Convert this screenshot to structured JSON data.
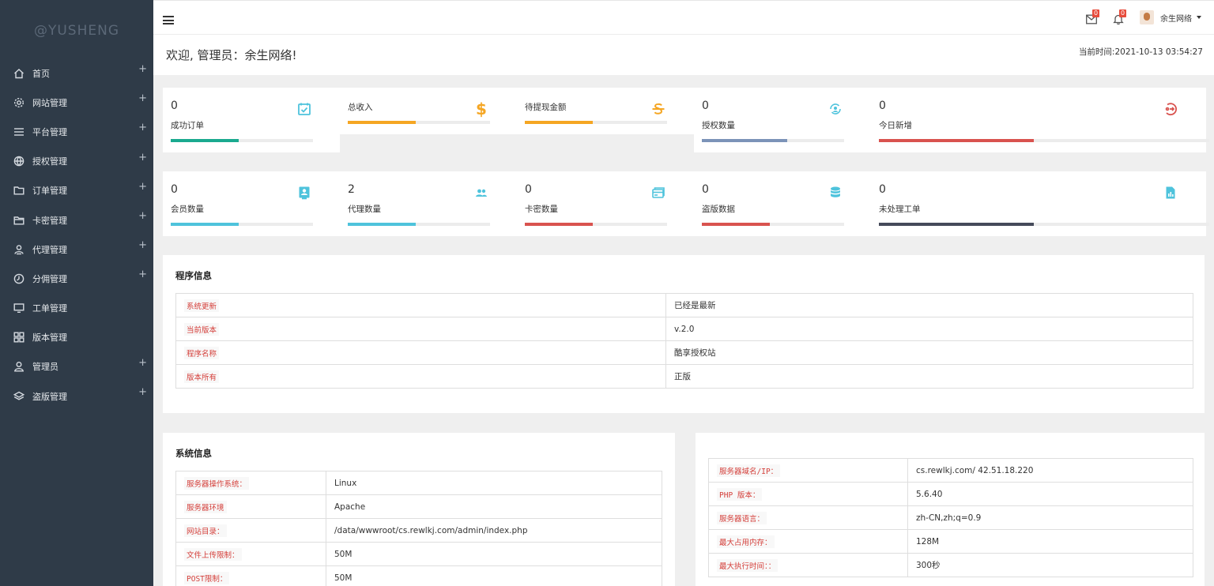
{
  "sidebar": {
    "brand": "@YUSHENG",
    "items": [
      {
        "label": "首页",
        "icon": "home-icon",
        "expandable": true
      },
      {
        "label": "网站管理",
        "icon": "gear-icon",
        "expandable": true
      },
      {
        "label": "平台管理",
        "icon": "menu-lines-icon",
        "expandable": true
      },
      {
        "label": "授权管理",
        "icon": "globe-icon",
        "expandable": true
      },
      {
        "label": "订单管理",
        "icon": "folder-icon",
        "expandable": true
      },
      {
        "label": "卡密管理",
        "icon": "folder-open-icon",
        "expandable": true
      },
      {
        "label": "代理管理",
        "icon": "user-group-icon",
        "expandable": true
      },
      {
        "label": "分佣管理",
        "icon": "clock-icon",
        "expandable": true
      },
      {
        "label": "工单管理",
        "icon": "monitor-icon",
        "expandable": false
      },
      {
        "label": "版本管理",
        "icon": "grid-icon",
        "expandable": false
      },
      {
        "label": "管理员",
        "icon": "user-icon",
        "expandable": true
      },
      {
        "label": "盗版管理",
        "icon": "layers-icon",
        "expandable": true
      }
    ],
    "plus_glyph": "+"
  },
  "topbar": {
    "mail_badge": "0",
    "bell_badge": "0",
    "user_name": "余生网络"
  },
  "welcome": {
    "title": "欢迎, 管理员：余生网络!",
    "time": "当前时间:2021-10-13 03:54:27"
  },
  "stats_row1": [
    {
      "value": "0",
      "label": "成功订单",
      "icon": "calendar-check-icon",
      "color": "#1aa98f",
      "fill": 0.48
    },
    {
      "value": "",
      "label": "总收入",
      "icon": "dollar-icon",
      "color": "#f5a623",
      "fill": 0.48
    },
    {
      "value": "",
      "label": "待提现金额",
      "icon": "strike-s-icon",
      "color": "#f5a623",
      "fill": 0.48
    },
    {
      "value": "0",
      "label": "授权数量",
      "icon": "sync-user-icon",
      "color": "#7b93b8",
      "fill": 0.6
    },
    {
      "value": "0",
      "label": "今日新增",
      "icon": "arrow-circle-icon",
      "color": "#d9534f",
      "fill": 0.47
    }
  ],
  "stats_row2": [
    {
      "value": "0",
      "label": "会员数量",
      "icon": "id-card-icon",
      "color": "#4ec3dc",
      "fill": 0.48
    },
    {
      "value": "2",
      "label": "代理数量",
      "icon": "users-icon",
      "color": "#4ec3dc",
      "fill": 0.48
    },
    {
      "value": "0",
      "label": "卡密数量",
      "icon": "cards-icon",
      "color": "#d9534f",
      "fill": 0.48
    },
    {
      "value": "0",
      "label": "盗版数据",
      "icon": "database-icon",
      "color": "#d9534f",
      "fill": 0.48
    },
    {
      "value": "0",
      "label": "未处理工单",
      "icon": "report-icon",
      "color": "#454a5a",
      "fill": 0.47
    }
  ],
  "program": {
    "title": "程序信息",
    "rows": [
      {
        "key": "系统更新",
        "value": "已经是最新"
      },
      {
        "key": "当前版本",
        "value": "v.2.0"
      },
      {
        "key": "程序名称",
        "value": "酷享授权站"
      },
      {
        "key": "版本所有",
        "value": "正版"
      }
    ]
  },
  "system": {
    "title": "系统信息",
    "rows": [
      {
        "key": "服务器操作系统：",
        "value": "Linux"
      },
      {
        "key": "服务器环境",
        "value": "Apache"
      },
      {
        "key": "网站目录：",
        "value": "/data/wwwroot/cs.rewlkj.com/admin/index.php"
      },
      {
        "key": "文件上传限制：",
        "value": "50M"
      },
      {
        "key": "POST限制：",
        "value": "50M"
      }
    ]
  },
  "server": {
    "rows": [
      {
        "key": "服务器域名/IP：",
        "value": "cs.rewlkj.com/ 42.51.18.220"
      },
      {
        "key": "PHP 版本：",
        "value": "5.6.40"
      },
      {
        "key": "服务器语言：",
        "value": "zh-CN,zh;q=0.9"
      },
      {
        "key": "最大占用内存：",
        "value": "128M"
      },
      {
        "key": "最大执行时间：：",
        "value": "300秒"
      }
    ]
  }
}
